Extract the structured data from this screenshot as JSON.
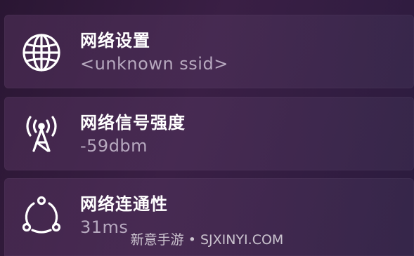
{
  "items": [
    {
      "title": "网络设置",
      "subtitle": "<unknown ssid>",
      "icon": "globe-icon"
    },
    {
      "title": "网络信号强度",
      "subtitle": "-59dbm",
      "icon": "signal-tower-icon"
    },
    {
      "title": "网络连通性",
      "subtitle": "31ms",
      "icon": "network-share-icon"
    }
  ],
  "watermark": "新意手游 • SJXINYI.COM",
  "colors": {
    "title": "#ffffff",
    "subtitle": "#b7a9bf",
    "icon": "#ffffff"
  }
}
